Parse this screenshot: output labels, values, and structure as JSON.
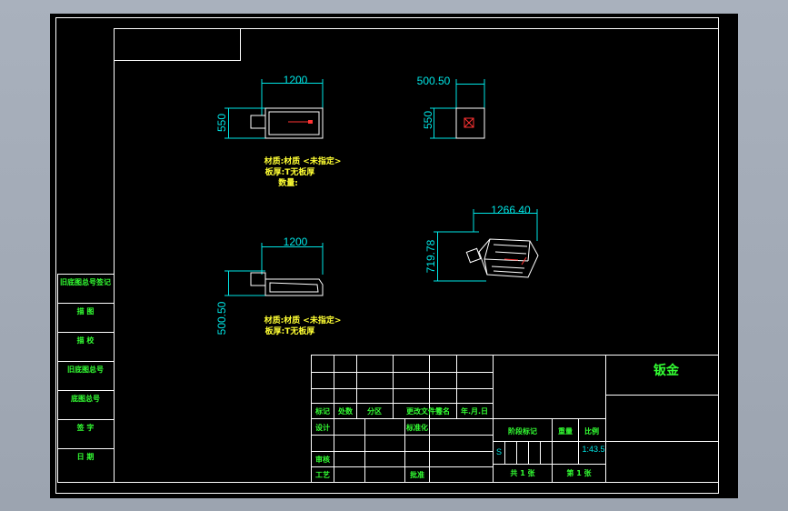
{
  "views": {
    "front": {
      "width": "1200",
      "height": "550"
    },
    "side": {
      "width": "500.50",
      "height": "550"
    },
    "top": {
      "width": "1200",
      "height": "500.50"
    },
    "iso": {
      "width": "1266.40",
      "height": "719.78"
    }
  },
  "notes": {
    "front": [
      "材质:材质 <未指定>",
      "板厚:T无板厚",
      "数量:"
    ],
    "top": [
      "材质:材质 <未指定>",
      "板厚:T无板厚"
    ]
  },
  "side_labels": [
    "旧底图总号签记",
    "描  图",
    "描  校",
    "旧底图总号",
    "底图总号",
    "签  字",
    "日  期"
  ],
  "title_block": {
    "header": [
      "标记",
      "处数",
      "分区",
      "更改文件号",
      "签名",
      "年.月.日"
    ],
    "rows": {
      "design": "设计",
      "standard": "标准化",
      "review": "审核",
      "process": "工艺",
      "approve": "批准"
    },
    "stage_mark": "阶段标记",
    "weight": "重量",
    "scale": "比例",
    "stage_value": "S",
    "scale_value": "1:43.5",
    "sheets_total": "共 1 张",
    "sheet_no": "第 1 张",
    "drawing_name": "钣金"
  }
}
